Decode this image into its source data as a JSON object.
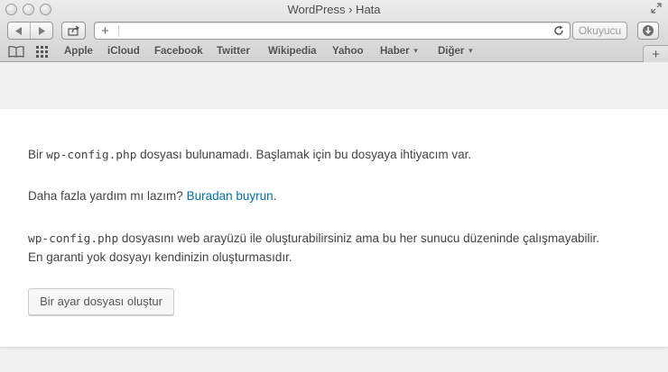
{
  "window": {
    "title": "WordPress › Hata"
  },
  "toolbar": {
    "address_value": "",
    "reader_label": "Okuyucu"
  },
  "bookmarks": {
    "items": [
      {
        "label": "Apple"
      },
      {
        "label": "iCloud"
      },
      {
        "label": "Facebook"
      },
      {
        "label": "Twitter"
      },
      {
        "label": "Wikipedia"
      },
      {
        "label": "Yahoo"
      },
      {
        "label": "Haber",
        "dropdown": true
      },
      {
        "label": "Diğer",
        "dropdown": true
      }
    ]
  },
  "page": {
    "p1_prefix": "Bir ",
    "p1_code": "wp-config.php",
    "p1_suffix": " dosyası bulunamadı. Başlamak için bu dosyaya ihtiyacım var.",
    "p2_prefix": "Daha fazla yardım mı lazım? ",
    "p2_link": "Buradan buyrun",
    "p2_suffix": ".",
    "p3_code": "wp-config.php",
    "p3_line1_suffix": " dosyasını web arayüzü ile oluşturabilirsiniz ama bu her sunucu düzeninde çalışmayabilir.",
    "p3_line2": "En garanti yok dosyayı kendinizin oluşturmasıdır.",
    "create_button": "Bir ayar dosyası oluştur"
  },
  "colors": {
    "link": "#0073aa",
    "text": "#444444",
    "page_bg": "#f1f1f1"
  }
}
